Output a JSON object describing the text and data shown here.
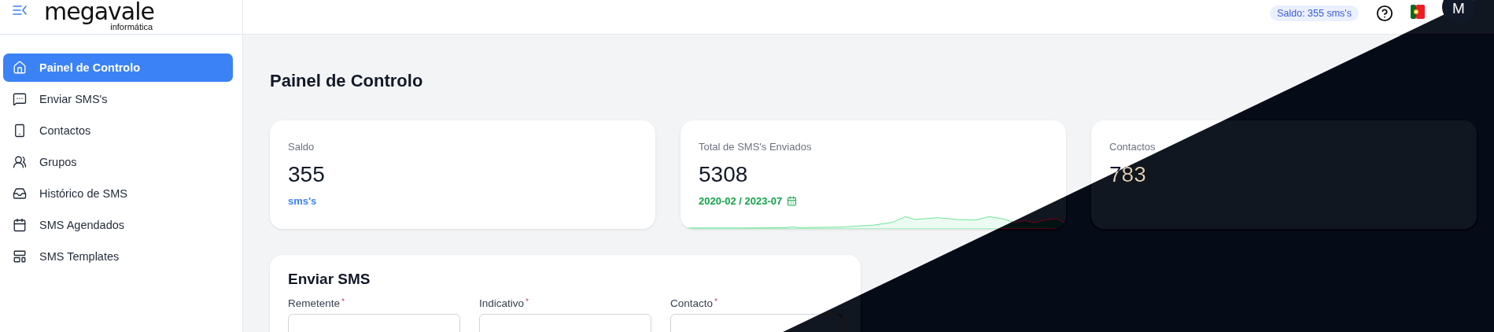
{
  "logo": {
    "name": "megavale",
    "tagline": "informática"
  },
  "sidebar": {
    "items": [
      {
        "label": "Painel de Controlo",
        "selected": true
      },
      {
        "label": "Enviar SMS's",
        "selected": false
      },
      {
        "label": "Contactos",
        "selected": false
      },
      {
        "label": "Grupos",
        "selected": false
      },
      {
        "label": "Histórico de SMS",
        "selected": false
      },
      {
        "label": "SMS Agendados",
        "selected": false
      },
      {
        "label": "SMS Templates",
        "selected": false
      }
    ]
  },
  "topbar": {
    "balance_badge": "Saldo: 355 sms's",
    "avatar_initial": "M"
  },
  "page_title": "Painel de Controlo",
  "stats": [
    {
      "label": "Saldo",
      "value": "355",
      "footer": "sms's",
      "kind": "link"
    },
    {
      "label": "Total de SMS's Enviados",
      "value": "5308",
      "footer": "2020-02 / 2023-07",
      "kind": "range"
    },
    {
      "label": "Contactos",
      "value": "783",
      "kind": "plain"
    }
  ],
  "send_form": {
    "title": "Enviar SMS",
    "fields": [
      {
        "label": "Remetente",
        "required_mark": "*"
      },
      {
        "label": "Indicativo",
        "required_mark": "*"
      },
      {
        "label": "Contacto",
        "required_mark": "*"
      }
    ]
  },
  "dark_mode_transition": true
}
